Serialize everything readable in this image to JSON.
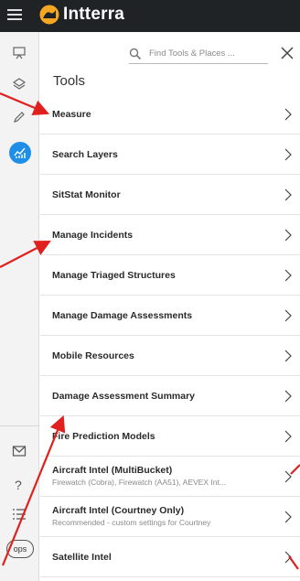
{
  "app": {
    "name": "Intterra"
  },
  "search": {
    "placeholder": "Find Tools & Places ..."
  },
  "panel": {
    "title": "Tools"
  },
  "rail": {
    "ops_label": "ops",
    "help_label": "?"
  },
  "tools": [
    {
      "label": "Measure",
      "sub": ""
    },
    {
      "label": "Search Layers",
      "sub": ""
    },
    {
      "label": "SitStat Monitor",
      "sub": ""
    },
    {
      "label": "Manage Incidents",
      "sub": ""
    },
    {
      "label": "Manage Triaged Structures",
      "sub": ""
    },
    {
      "label": "Manage Damage Assessments",
      "sub": ""
    },
    {
      "label": "Mobile Resources",
      "sub": ""
    },
    {
      "label": "Damage Assessment Summary",
      "sub": ""
    },
    {
      "label": "Fire Prediction Models",
      "sub": ""
    },
    {
      "label": "Aircraft Intel (MultiBucket)",
      "sub": "Firewatch (Cobra), Firewatch (AA51), AEVEX Int..."
    },
    {
      "label": "Aircraft Intel (Courtney Only)",
      "sub": "Recommended - custom settings for Courtney"
    },
    {
      "label": "Satellite Intel",
      "sub": ""
    }
  ],
  "colors": {
    "topbar": "#1f2326",
    "accent": "#1e8ee6",
    "logo": "#f5a623",
    "annotation": "#e0201e"
  }
}
